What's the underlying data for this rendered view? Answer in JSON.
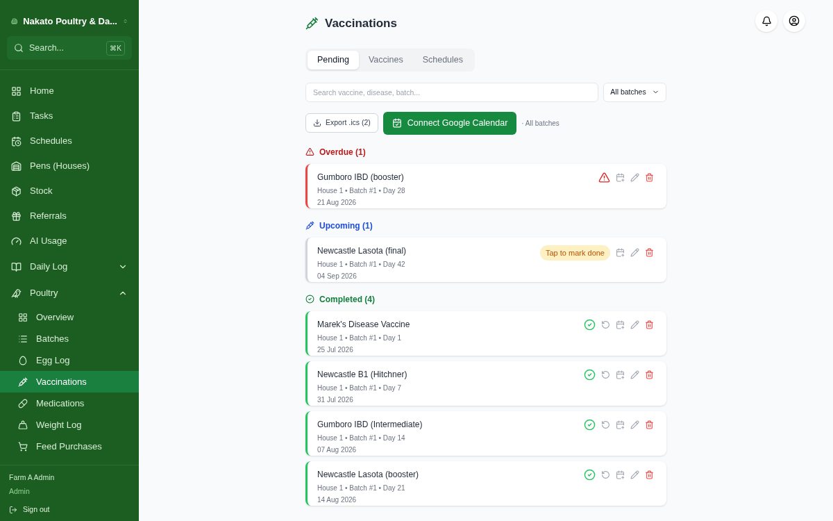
{
  "sidebar": {
    "farm_name": "Nakato Poultry & Da...",
    "search": {
      "placeholder": "Search...",
      "shortcut": "⌘K"
    },
    "nav": [
      {
        "kind": "link",
        "label": "Home",
        "selected": false
      },
      {
        "kind": "link",
        "label": "Tasks",
        "selected": false
      },
      {
        "kind": "link",
        "label": "Schedules",
        "selected": false
      },
      {
        "kind": "link",
        "label": "Pens (Houses)",
        "selected": false
      },
      {
        "kind": "link",
        "label": "Stock",
        "selected": false
      },
      {
        "kind": "link",
        "label": "Referrals",
        "selected": false
      },
      {
        "kind": "link",
        "label": "AI Usage",
        "selected": false
      },
      {
        "kind": "group",
        "label": "Daily Log",
        "expanded": false
      },
      {
        "kind": "group",
        "label": "Poultry",
        "expanded": true,
        "children": [
          {
            "label": "Overview",
            "selected": false
          },
          {
            "label": "Batches",
            "selected": false
          },
          {
            "label": "Egg Log",
            "selected": false
          },
          {
            "label": "Vaccinations",
            "selected": true
          },
          {
            "label": "Medications",
            "selected": false
          },
          {
            "label": "Weight Log",
            "selected": false
          },
          {
            "label": "Feed Purchases",
            "selected": false
          }
        ]
      }
    ],
    "user": {
      "name": "Farm A Admin",
      "role": "Admin"
    },
    "sign_out": "Sign out"
  },
  "main": {
    "title": "Vaccinations",
    "tabs": [
      {
        "label": "Pending",
        "selected": true
      },
      {
        "label": "Vaccines",
        "selected": false
      },
      {
        "label": "Schedules",
        "selected": false
      }
    ],
    "search": {
      "placeholder": "Search vaccine, disease, batch..."
    },
    "batch_filter": "All batches",
    "export_button": "Export .ics (2)",
    "connect_button": "Connect Google Calendar",
    "scope_note": "· All batches",
    "sections": [
      {
        "kind": "overdue",
        "title": "Overdue (1)",
        "items": [
          {
            "name": "Gumboro IBD (booster)",
            "meta": "House 1 • Batch #1 • Day 28",
            "date": "21 Aug 2026"
          }
        ]
      },
      {
        "kind": "upcoming",
        "title": "Upcoming (1)",
        "items": [
          {
            "name": "Newcastle Lasota (final)",
            "meta": "House 1 • Batch #1 • Day 42",
            "date": "04 Sep 2026",
            "badge": "Tap to mark done"
          }
        ]
      },
      {
        "kind": "completed",
        "title": "Completed (4)",
        "items": [
          {
            "name": "Marek's Disease Vaccine",
            "meta": "House 1 • Batch #1 • Day 1",
            "date": "25 Jul 2026"
          },
          {
            "name": "Newcastle B1 (Hitchner)",
            "meta": "House 1 • Batch #1 • Day 7",
            "date": "31 Jul 2026"
          },
          {
            "name": "Gumboro IBD (Intermediate)",
            "meta": "House 1 • Batch #1 • Day 14",
            "date": "07 Aug 2026"
          },
          {
            "name": "Newcastle Lasota (booster)",
            "meta": "House 1 • Batch #1 • Day 21",
            "date": "14 Aug 2026"
          }
        ]
      }
    ]
  }
}
